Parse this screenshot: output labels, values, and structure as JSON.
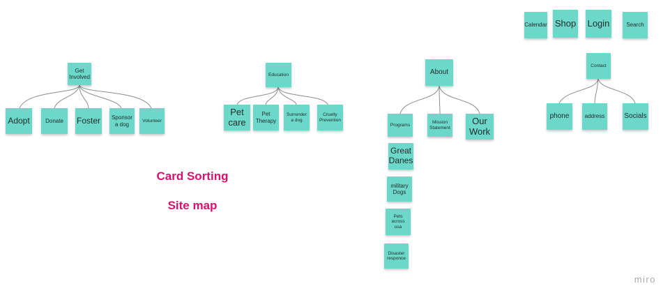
{
  "captions": {
    "title": "Card Sorting",
    "subtitle": "Site map"
  },
  "watermark": "miro",
  "colors": {
    "note": "#6cd8c9",
    "caption": "#d4126f",
    "connector": "#8c8c8c"
  },
  "utility_nav": [
    "Calendar",
    "Shop",
    "Login",
    "Search"
  ],
  "groups": {
    "get_involved": {
      "label": "Get\nInvolved",
      "children": [
        "Adopt",
        "Donate",
        "Foster",
        "Sponsor\na dog",
        "Volunteer"
      ]
    },
    "education": {
      "label": "Education",
      "children": [
        "Pet\ncare",
        "Pet\nTherapy",
        "Surrender\na dog",
        "Cruelty\nPrevention"
      ]
    },
    "about": {
      "label": "About",
      "children": [
        "Programs",
        "Mission\nStatement",
        "Our\nWork"
      ],
      "programs": [
        "Great\nDanes",
        "military\nDogs",
        "Pets\nacross\nusa",
        "Disaster\nresponce"
      ]
    },
    "contact": {
      "label": "Contact",
      "children": [
        "phone",
        "address",
        "Socials"
      ]
    }
  }
}
